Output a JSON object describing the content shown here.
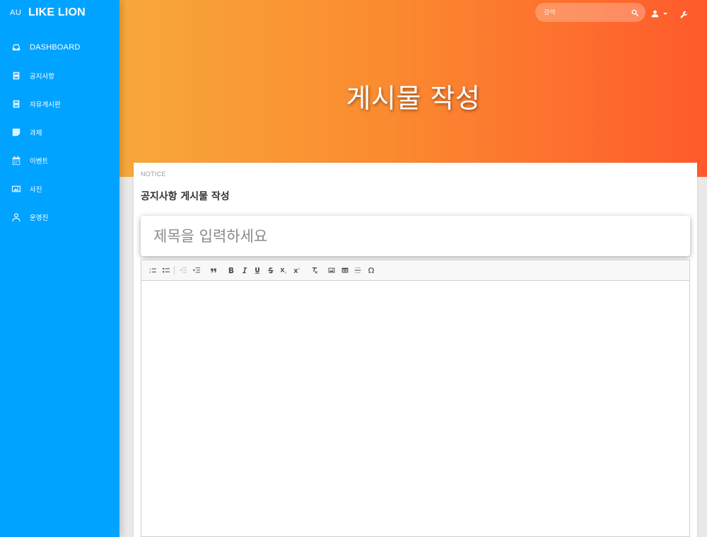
{
  "sidebar": {
    "brand_mini": "AU",
    "brand_full": "LIKE LION",
    "items": [
      {
        "label": "DASHBOARD",
        "icon": "inbox-icon"
      },
      {
        "label": "공지사항",
        "icon": "book-icon"
      },
      {
        "label": "자유게시판",
        "icon": "book-icon"
      },
      {
        "label": "과제",
        "icon": "note-icon"
      },
      {
        "label": "이벤트",
        "icon": "calendar-icon"
      },
      {
        "label": "사진",
        "icon": "image-icon"
      },
      {
        "label": "운영진",
        "icon": "user-icon"
      }
    ]
  },
  "header": {
    "title": "게시물 작성",
    "search_placeholder": "검색",
    "gradient": [
      "#f7a83b",
      "#ff5a2c"
    ]
  },
  "card": {
    "category": "NOTICE",
    "title": "공지사항 게시물 작성",
    "title_placeholder": "제목을 입력하세요"
  },
  "toolbar": {
    "items": [
      "numbered-list-icon",
      "bulleted-list-icon",
      "outdent-icon",
      "indent-icon",
      "blockquote-icon",
      "bold-icon",
      "italic-icon",
      "underline-icon",
      "strikethrough-icon",
      "subscript-icon",
      "superscript-icon",
      "remove-format-icon",
      "image-icon",
      "table-icon",
      "horizontal-line-icon",
      "special-character-icon"
    ]
  },
  "colors": {
    "sidebar": "#00a3ff",
    "background": "#e9e9e9"
  }
}
